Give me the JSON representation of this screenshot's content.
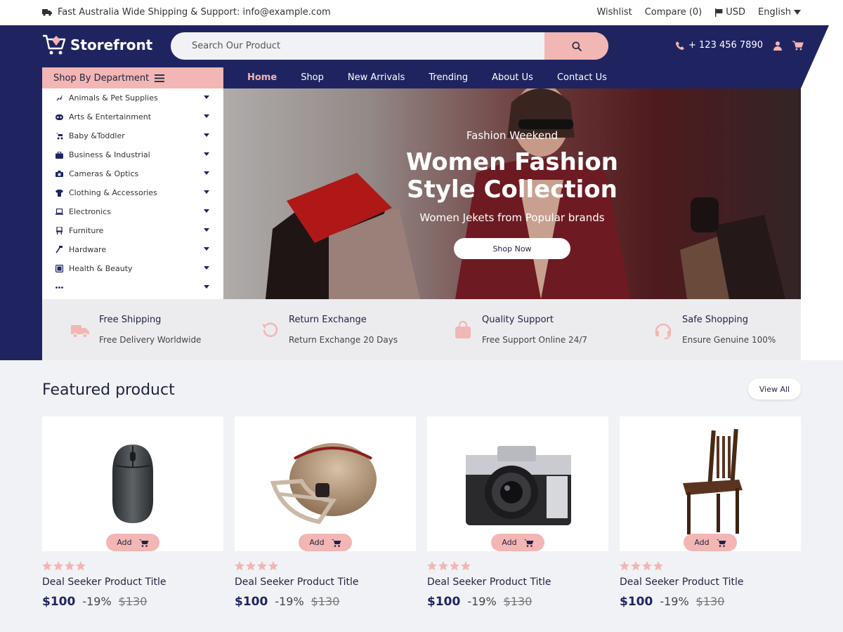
{
  "colors": {
    "navy": "#1f2461",
    "pink": "#f2b6b4",
    "bg": "#f1f2f6"
  },
  "topbar": {
    "shipping_text": "Fast Australia Wide Shipping & Support: info@example.com",
    "wishlist": "Wishlist",
    "compare": "Compare (0)",
    "currency": "USD",
    "language": "English"
  },
  "header": {
    "logo_text": "Storefront",
    "search_placeholder": "Search Our Product",
    "phone": "+ 123 456 7890"
  },
  "department": {
    "title": "Shop By Department",
    "items": [
      {
        "label": "Animals & Pet Supplies",
        "icon": "paw-icon"
      },
      {
        "label": "Arts & Entertainment",
        "icon": "mask-icon"
      },
      {
        "label": "Baby &Toddler",
        "icon": "stroller-icon"
      },
      {
        "label": "Business & Industrial",
        "icon": "briefcase-icon"
      },
      {
        "label": "Cameras & Optics",
        "icon": "camera-icon"
      },
      {
        "label": "Clothing & Accessories",
        "icon": "tshirt-icon"
      },
      {
        "label": "Electronics",
        "icon": "laptop-icon"
      },
      {
        "label": "Furniture",
        "icon": "chair-icon"
      },
      {
        "label": "Hardware",
        "icon": "hammer-icon"
      },
      {
        "label": "Health & Beauty",
        "icon": "health-icon"
      },
      {
        "label": "",
        "icon": "ellipsis-icon"
      }
    ]
  },
  "nav": {
    "items": [
      "Home",
      "Shop",
      "New Arrivals",
      "Trending",
      "About Us",
      "Contact Us"
    ],
    "active": "Home"
  },
  "hero": {
    "kicker": "Fashion Weekend",
    "title_line1": "Women Fashion",
    "title_line2": "Style Collection",
    "subtitle": "Women Jekets from  Popular brands",
    "button": "Shop Now"
  },
  "features": [
    {
      "title": "Free Shipping",
      "subtitle": "Free Delivery Worldwide",
      "icon": "truck-icon"
    },
    {
      "title": "Return Exchange",
      "subtitle": "Return Exchange 20 Days",
      "icon": "return-icon"
    },
    {
      "title": "Quality Support",
      "subtitle": "Free Support Online 24/7",
      "icon": "bag-icon"
    },
    {
      "title": "Safe Shopping",
      "subtitle": "Ensure Genuine 100%",
      "icon": "headset-icon"
    }
  ],
  "featured": {
    "title": "Featured product",
    "view_all": "View All",
    "products": [
      {
        "title": "Deal Seeker Product Title",
        "price": "$100",
        "discount": "-19%",
        "old_price": "$130",
        "add_label": "Add",
        "rating": 4,
        "image": "computer-mouse"
      },
      {
        "title": "Deal Seeker Product Title",
        "price": "$100",
        "discount": "-19%",
        "old_price": "$130",
        "add_label": "Add",
        "rating": 4,
        "image": "football-helmet"
      },
      {
        "title": "Deal Seeker Product Title",
        "price": "$100",
        "discount": "-19%",
        "old_price": "$130",
        "add_label": "Add",
        "rating": 4,
        "image": "film-camera"
      },
      {
        "title": "Deal Seeker Product Title",
        "price": "$100",
        "discount": "-19%",
        "old_price": "$130",
        "add_label": "Add",
        "rating": 4,
        "image": "wooden-chair"
      }
    ]
  }
}
